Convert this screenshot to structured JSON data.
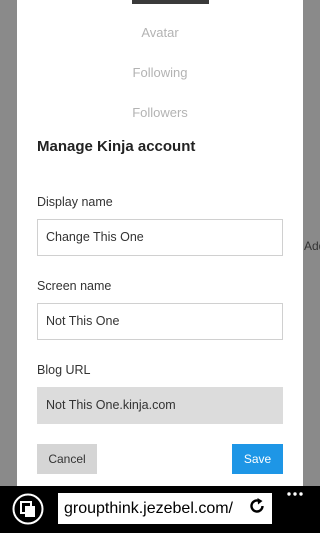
{
  "profile_nav": {
    "avatar_label": "Avatar",
    "following_label": "Following",
    "followers_label": "Followers"
  },
  "account": {
    "title": "Manage Kinja account",
    "display_name_label": "Display name",
    "display_name_value": "Change This One",
    "screen_name_label": "Screen name",
    "screen_name_value": "Not This One",
    "blog_url_label": "Blog URL",
    "blog_url_value": "Not This One.kinja.com",
    "cancel_label": "Cancel",
    "save_label": "Save"
  },
  "background": {
    "partial_text": "Add"
  },
  "browser": {
    "url": "groupthink.jezebel.com/"
  },
  "colors": {
    "save_button": "#1e96e6",
    "cancel_button": "#d5d5d5",
    "readonly_field": "#dcdcdc",
    "overlay": "#8a8a8a"
  }
}
